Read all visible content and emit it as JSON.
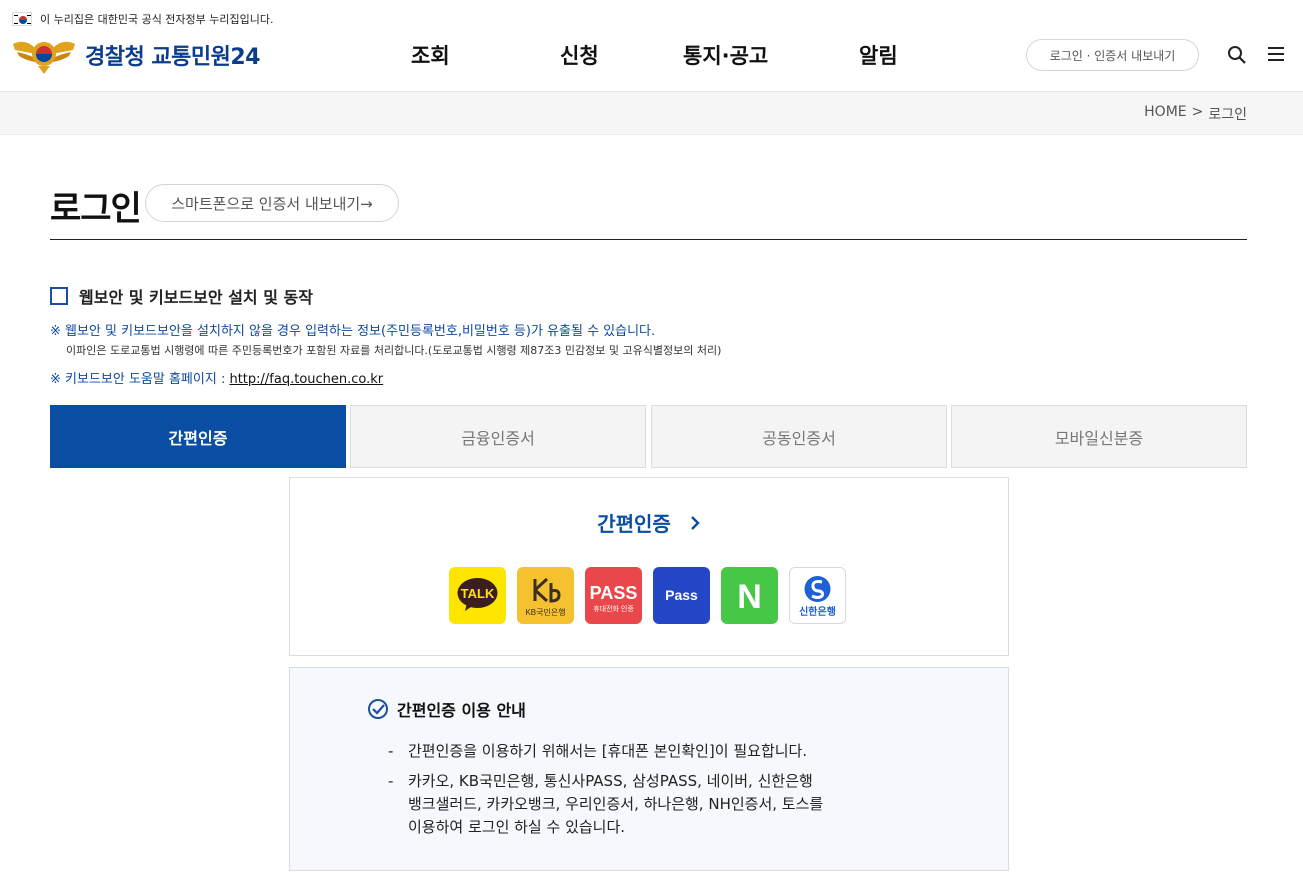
{
  "gov_banner": {
    "text": "이 누리집은 대한민국 공식 전자정부 누리집입니다."
  },
  "header": {
    "logo_text": "경찰청 교통민원24",
    "nav": [
      "조회",
      "신청",
      "통지·공고",
      "알림"
    ],
    "login_pill": "로그인 · 인증서 내보내기"
  },
  "breadcrumb": {
    "home": "HOME",
    "separator": ">",
    "current": "로그인"
  },
  "page": {
    "title": "로그인",
    "export_button": "스마트폰으로 인증서 내보내기→"
  },
  "security": {
    "checkbox_label": "웹보안 및 키보드보안 설치 및 동작",
    "notice1": "※ 웹보안 및 키보드보안을 설치하지 않을 경우 입력하는 정보(주민등록번호,비밀번호 등)가 유출될 수 있습니다.",
    "notice2": "이파인은 도로교통법 시행령에 따른 주민등록번호가 포함된 자료를 처리합니다.(도로교통법 시행령 제87조3 민감정보 및 고유식별정보의 처리)",
    "notice3_prefix": "※ 키보드보안 도움말 홈페이지 : ",
    "notice3_link": "http://faq.touchen.co.kr"
  },
  "tabs": [
    "간편인증",
    "금융인증서",
    "공동인증서",
    "모바일신분증"
  ],
  "simple_auth": {
    "title": "간편인증",
    "providers": [
      {
        "name": "kakao-talk",
        "label": "TALK",
        "bg": "#fee500"
      },
      {
        "name": "kb-bank",
        "label": "KB국민은행",
        "bg": "#f5c12e"
      },
      {
        "name": "pass",
        "label": "PASS",
        "sub": "휴대전화 인증",
        "bg": "#e9474b"
      },
      {
        "name": "samsung-pass",
        "label": "Pass",
        "bg": "#2447c7"
      },
      {
        "name": "naver",
        "label": "N",
        "bg": "#46c748"
      },
      {
        "name": "shinhan",
        "label": "신한은행",
        "bg": "#ffffff"
      }
    ]
  },
  "info": {
    "title": "간편인증 이용 안내",
    "items": [
      "간편인증을 이용하기 위해서는 [휴대폰 본인확인]이 필요합니다.",
      "카카오, KB국민은행, 통신사PASS, 삼성PASS, 네이버, 신한은행\n뱅크샐러드, 카카오뱅크, 우리인증서, 하나은행, NH인증서, 토스를\n이용하여 로그인 하실 수 있습니다."
    ]
  }
}
